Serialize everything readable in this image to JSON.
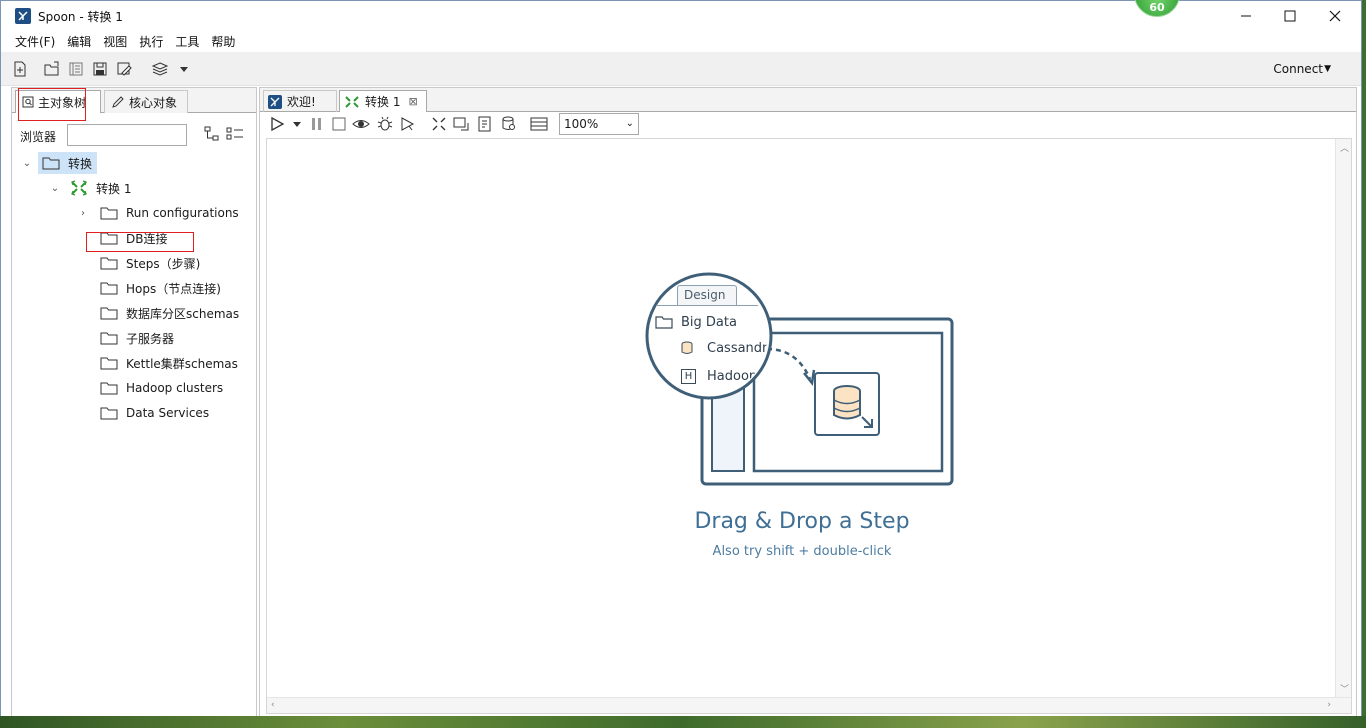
{
  "window": {
    "title": "Spoon - 转换 1",
    "badge": "60"
  },
  "menu": [
    "文件(F)",
    "编辑",
    "视图",
    "执行",
    "工具",
    "帮助"
  ],
  "toolbar": {
    "connect_label": "Connect"
  },
  "left_panel": {
    "tabs": [
      {
        "label": "主对象树"
      },
      {
        "label": "核心对象"
      }
    ],
    "browser_label": "浏览器",
    "search_value": "",
    "tree": {
      "root": "转换",
      "transform": "转换 1",
      "items": [
        "Run configurations",
        "DB连接",
        "Steps（步骤)",
        "Hops（节点连接)",
        "数据库分区schemas",
        "子服务器",
        "Kettle集群schemas",
        "Hadoop clusters",
        "Data Services"
      ]
    }
  },
  "editor": {
    "tabs": [
      {
        "label": "欢迎!"
      },
      {
        "label": "转换 1"
      }
    ],
    "zoom": "100%",
    "illustration": {
      "tab_label": "Design",
      "folder_label": "Big Data",
      "item1": "Cassandr",
      "item2": "Hadoop",
      "hadoop_letter": "H"
    },
    "drag_title": "Drag & Drop a Step",
    "drag_subtitle": "Also try shift + double-click"
  },
  "colors": {
    "accent": "#3f6f95",
    "selection": "#cde3f7",
    "highlight_box": "#e02020",
    "transform_icon": "#2e9a33"
  }
}
